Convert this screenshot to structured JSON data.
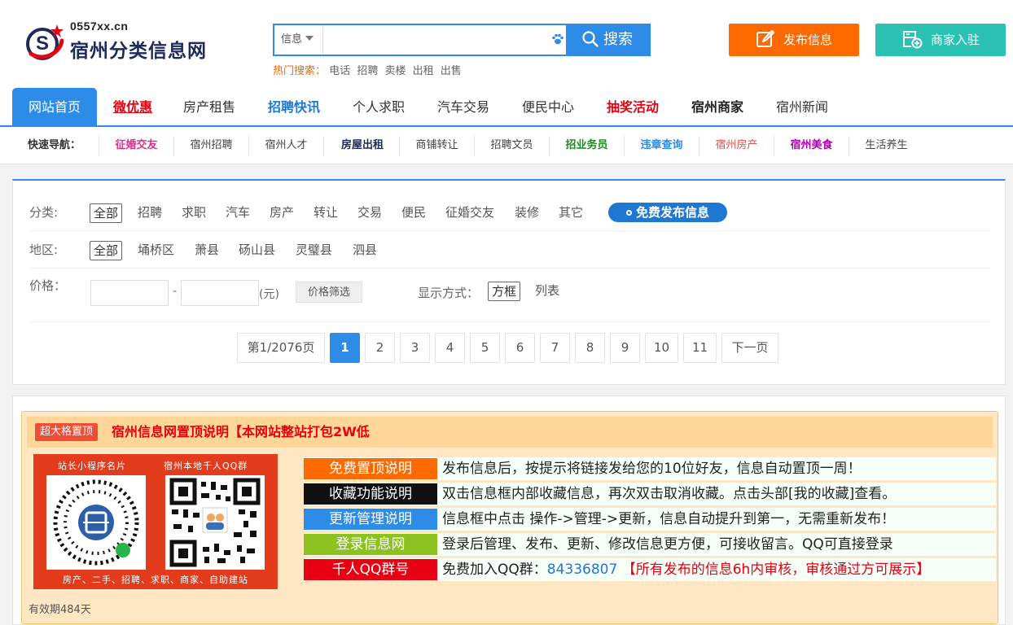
{
  "header": {
    "site_url": "0557xx.cn",
    "site_name": "宿州分类信息网",
    "search_scope": "信息",
    "search_value": "",
    "search_button": "搜索",
    "hot_label": "热门搜索：",
    "hot_keywords": [
      "电话",
      "招聘",
      "卖楼",
      "出租",
      "出售"
    ],
    "post_button": "发布信息",
    "merchant_button": "商家入驻",
    "colors": {
      "primary": "#2d8ce8",
      "post": "#ff6a00",
      "merchant": "#2bc2b3"
    }
  },
  "mainnav": [
    {
      "label": "网站首页"
    },
    {
      "label": "微优惠"
    },
    {
      "label": "房产租售"
    },
    {
      "label": "招聘快讯"
    },
    {
      "label": "个人求职"
    },
    {
      "label": "汽车交易"
    },
    {
      "label": "便民中心"
    },
    {
      "label": "抽奖活动"
    },
    {
      "label": "宿州商家"
    },
    {
      "label": "宿州新闻"
    }
  ],
  "quicknav": {
    "label": "快速导航：",
    "items": [
      {
        "label": "征婚交友",
        "color": "#d6338a"
      },
      {
        "label": "宿州招聘",
        "color": "#444444"
      },
      {
        "label": "宿州人才",
        "color": "#444444"
      },
      {
        "label": "房屋出租",
        "color": "#1d2a5a"
      },
      {
        "label": "商铺转让",
        "color": "#444444"
      },
      {
        "label": "招聘文员",
        "color": "#444444"
      },
      {
        "label": "招业务员",
        "color": "#1f8a1f"
      },
      {
        "label": "违章查询",
        "color": "#2d8ce8"
      },
      {
        "label": "宿州房产",
        "color": "#d9534f"
      },
      {
        "label": "宿州美食",
        "color": "#b100b1"
      },
      {
        "label": "生活养生",
        "color": "#444444"
      }
    ]
  },
  "filter": {
    "category_label": "分类:",
    "categories": [
      "全部",
      "招聘",
      "求职",
      "汽车",
      "房产",
      "转让",
      "交易",
      "便民",
      "征婚交友",
      "装修",
      "其它"
    ],
    "free_post": "免费发布信息",
    "region_label": "地区:",
    "regions": [
      "全部",
      "埇桥区",
      "萧县",
      "砀山县",
      "灵璧县",
      "泗县"
    ],
    "price_label": "价格：",
    "price_min": "",
    "price_max": "",
    "price_dash": "-",
    "price_unit": "(元)",
    "price_button": "价格筛选",
    "display_label": "显示方式：",
    "display_options": [
      "方框",
      "列表"
    ]
  },
  "pager": {
    "summary": "第1/2076页",
    "pages": [
      "1",
      "2",
      "3",
      "4",
      "5",
      "6",
      "7",
      "8",
      "9",
      "10",
      "11"
    ],
    "current": "1",
    "next": "下一页"
  },
  "top_listing": {
    "badge": "超大格置顶",
    "title": "宿州信息网置顶说明【本网站整站打包2W低",
    "qr_caption_left": "站长小程序名片",
    "qr_caption_right": "宿州本地千人QQ群",
    "qr_footer": "房产、二手、招聘、求职、商家、自助建站",
    "rows": [
      {
        "tag": "免费置顶说明",
        "tag_color": "#ff6a00",
        "text": "发布信息后，按提示将链接发给您的10位好友，信息自动置顶一周！"
      },
      {
        "tag": "收藏功能说明",
        "tag_color": "#111111",
        "text": "双击信息框内部收藏信息，再次双击取消收藏。点击头部[我的收藏]查看。"
      },
      {
        "tag": "更新管理说明",
        "tag_color": "#2d8ce8",
        "text": "信息框中点击 操作->管理->更新，信息自动提升到第一，无需重新发布！"
      },
      {
        "tag": "登录信息网",
        "tag_color": "#8cc21f",
        "text": "登录后管理、发布、更新、修改信息更方便，可接收留言。QQ可直接登录"
      },
      {
        "tag": "千人QQ群号",
        "tag_color": "#e60012",
        "text_prefix": "免费加入QQ群：",
        "qq_number": "84336807",
        "notice": "【所有发布的信息6h内审核，审核通过方可展示】"
      }
    ],
    "validity": "有效期484天"
  }
}
